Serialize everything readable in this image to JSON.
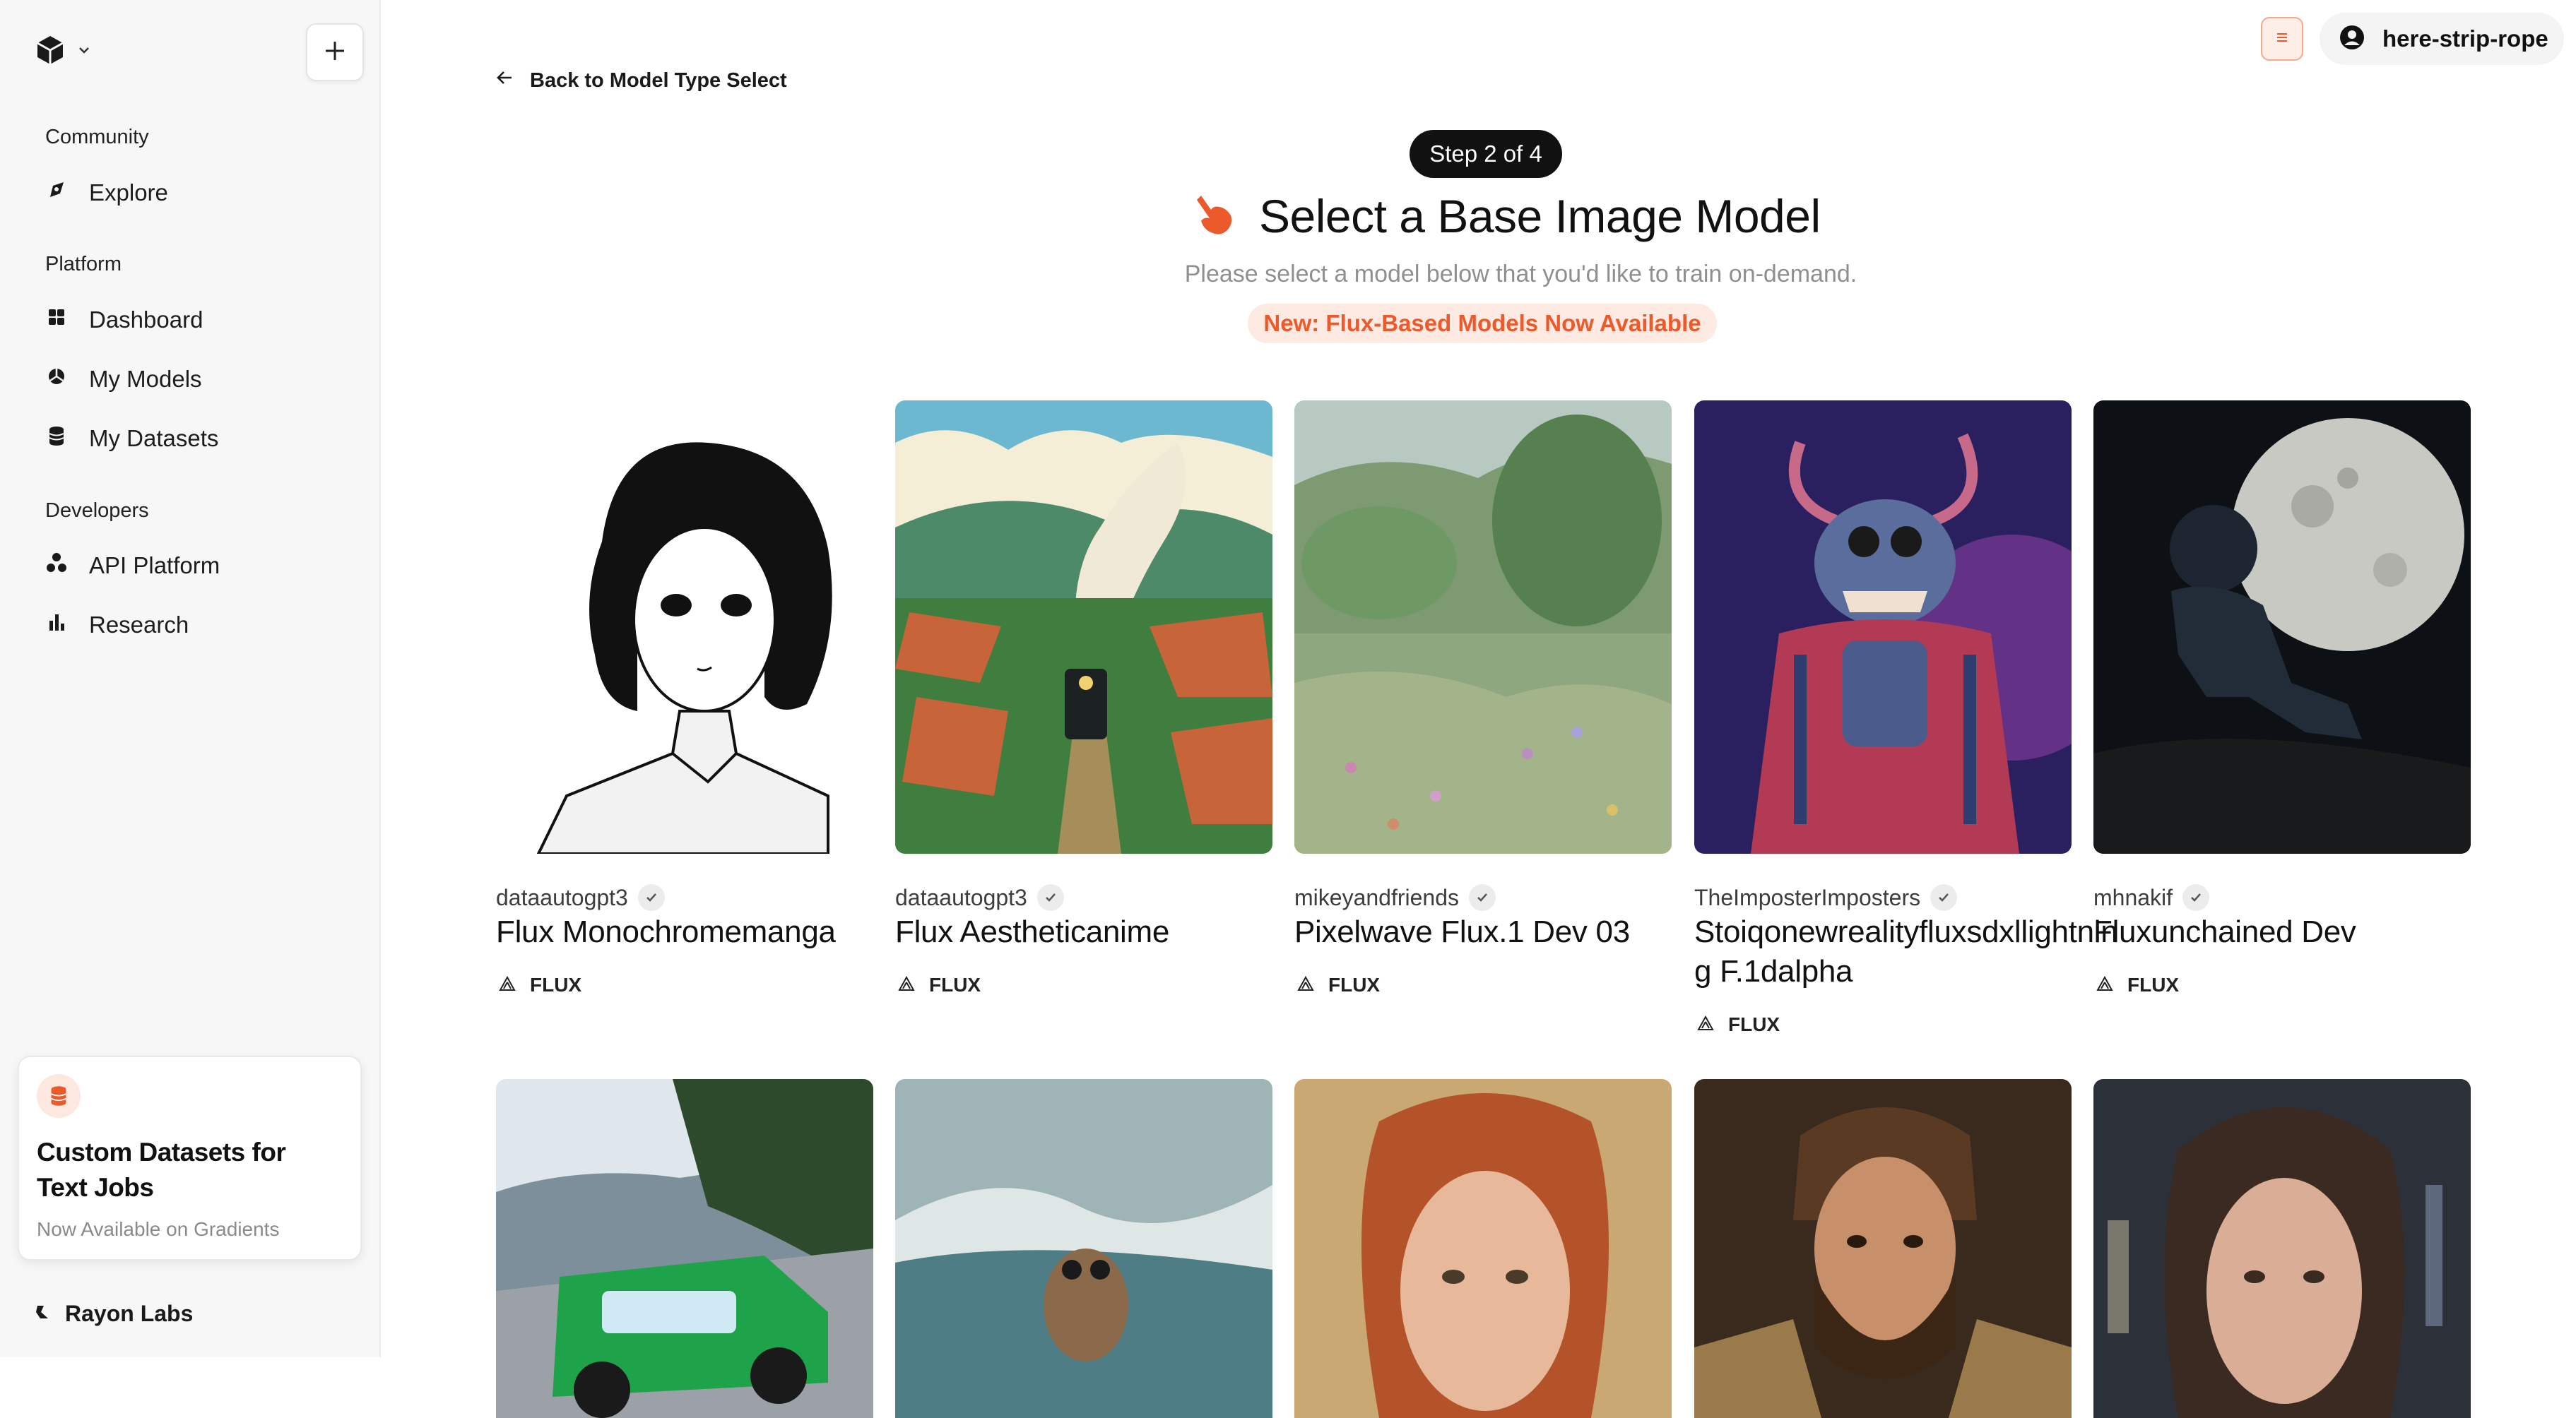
{
  "sidebar": {
    "sections": [
      {
        "title": "Community",
        "items": [
          {
            "label": "Explore",
            "icon": "compass-icon"
          }
        ]
      },
      {
        "title": "Platform",
        "items": [
          {
            "label": "Dashboard",
            "icon": "grid-icon"
          },
          {
            "label": "My Models",
            "icon": "models-icon"
          },
          {
            "label": "My Datasets",
            "icon": "database-icon"
          }
        ]
      },
      {
        "title": "Developers",
        "items": [
          {
            "label": "API Platform",
            "icon": "api-icon"
          },
          {
            "label": "Research",
            "icon": "bar-chart-icon"
          }
        ]
      }
    ],
    "promo": {
      "title": "Custom Datasets for Text Jobs",
      "subtitle": "Now Available on Gradients"
    },
    "footer_brand": "Rayon Labs"
  },
  "header": {
    "username": "here-strip-rope"
  },
  "main": {
    "back_label": "Back to Model Type Select",
    "step_label": "Step 2 of 4",
    "title": "Select a Base Image Model",
    "subtitle": "Please select a model below that you'd like to train on-demand.",
    "badge": "New: Flux-Based Models Now Available",
    "models": [
      {
        "author": "dataautogpt3",
        "name": "Flux Monochromemanga",
        "tag": "FLUX"
      },
      {
        "author": "dataautogpt3",
        "name": "Flux Aestheticanime",
        "tag": "FLUX"
      },
      {
        "author": "mikeyandfriends",
        "name": "Pixelwave Flux.1 Dev 03",
        "tag": "FLUX"
      },
      {
        "author": "TheImposterImposters",
        "name": "Stoiqonewrealityfluxsdxllightning F.1dalpha",
        "tag": "FLUX"
      },
      {
        "author": "mhnakif",
        "name": "Fluxunchained Dev",
        "tag": "FLUX"
      }
    ]
  },
  "colors": {
    "accent": "#ec5a2c",
    "badge_bg": "#fdeae3",
    "sidebar_bg": "#f7f7f7",
    "text_dark": "#111111",
    "text_muted": "#8f8f8f"
  }
}
